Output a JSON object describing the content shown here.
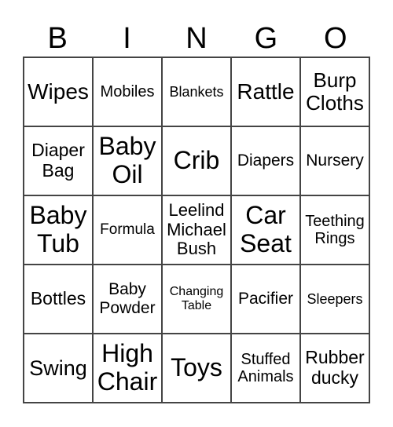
{
  "header": [
    "B",
    "I",
    "N",
    "G",
    "O"
  ],
  "cells": [
    [
      "Wipes",
      "Mobiles",
      "Blankets",
      "Rattle",
      "Burp Cloths"
    ],
    [
      "Diaper Bag",
      "Baby Oil",
      "Crib",
      "Diapers",
      "Nursery"
    ],
    [
      "Baby Tub",
      "Formula",
      "Leelind Michael Bush",
      "Car Seat",
      "Teething Rings"
    ],
    [
      "Bottles",
      "Baby Powder",
      "Changing Table",
      "Pacifier",
      "Sleepers"
    ],
    [
      "Swing",
      "High Chair",
      "Toys",
      "Stuffed Animals",
      "Rubber ducky"
    ]
  ]
}
